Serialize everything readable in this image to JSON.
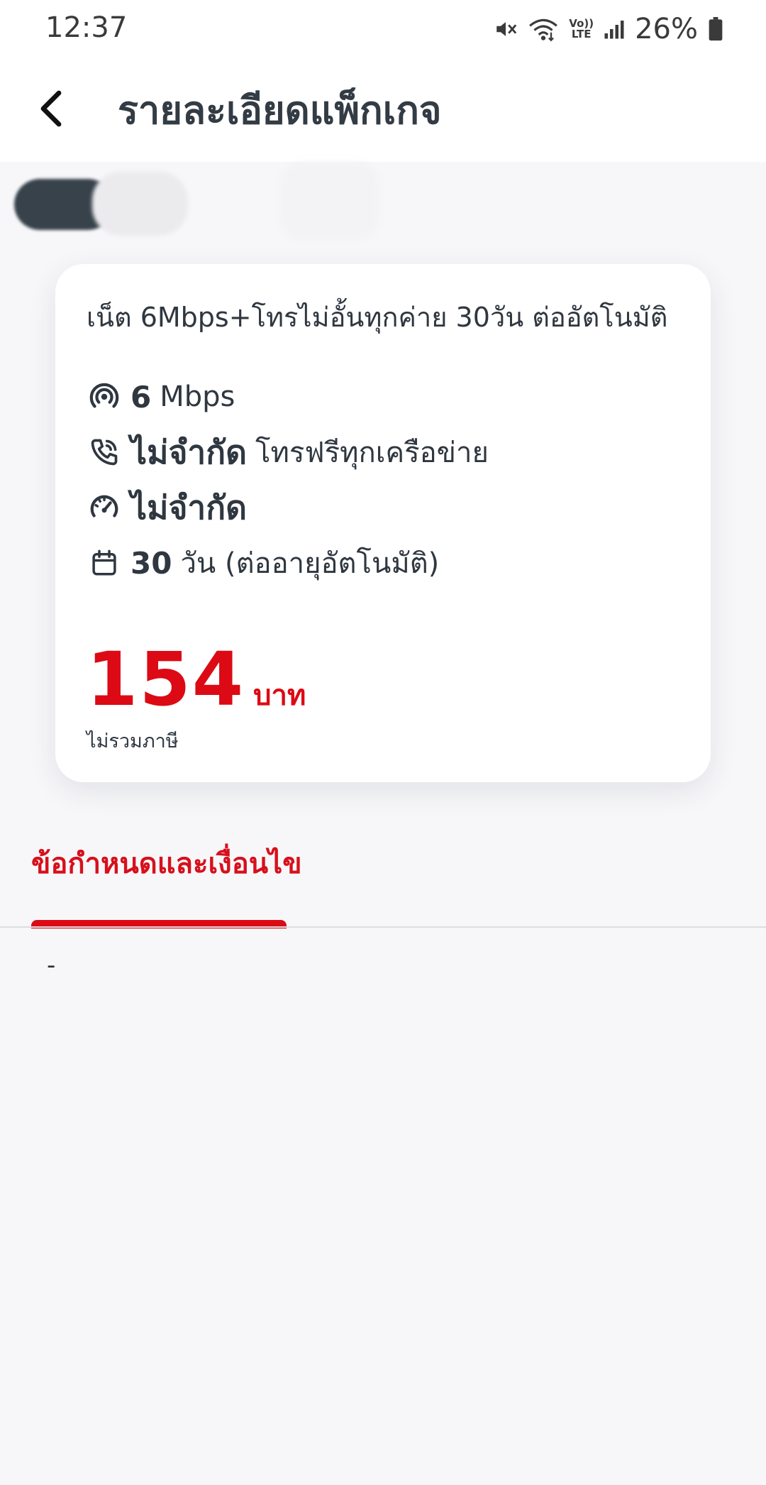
{
  "status_bar": {
    "time": "12:37",
    "volte_top": "Vo))",
    "volte_bottom": "LTE",
    "battery": "26%",
    "icons": [
      "mute-icon",
      "wifi-icon",
      "volte-icon",
      "signal-icon",
      "battery-icon"
    ]
  },
  "header": {
    "title": "รายละเอียดแพ็กเกจ",
    "back_icon": "chevron-left-icon"
  },
  "package": {
    "name": "เน็ต 6Mbps+โทรไม่อั้นทุกค่าย 30วัน ต่ออัตโนมัติ",
    "features": {
      "speed": {
        "icon": "signal-broadcast-icon",
        "value": "6",
        "text": "Mbps"
      },
      "calls": {
        "icon": "phone-icon",
        "value": "ไม่จำกัด",
        "text": "โทรฟรีทุกเครือข่าย"
      },
      "data": {
        "icon": "speedometer-icon",
        "value": "ไม่จำกัด"
      },
      "validity": {
        "icon": "calendar-icon",
        "value": "30",
        "text": "วัน (ต่ออายุอัตโนมัติ)"
      }
    },
    "price": "154",
    "currency": "บาท",
    "tax_note": "ไม่รวมภาษี"
  },
  "tabs": {
    "terms_label": "ข้อกำหนดและเงื่อนไข"
  },
  "terms_content": "-",
  "colors": {
    "accent": "#dc0a14",
    "text": "#2f3740",
    "background": "#f7f7f9",
    "card": "#ffffff"
  }
}
